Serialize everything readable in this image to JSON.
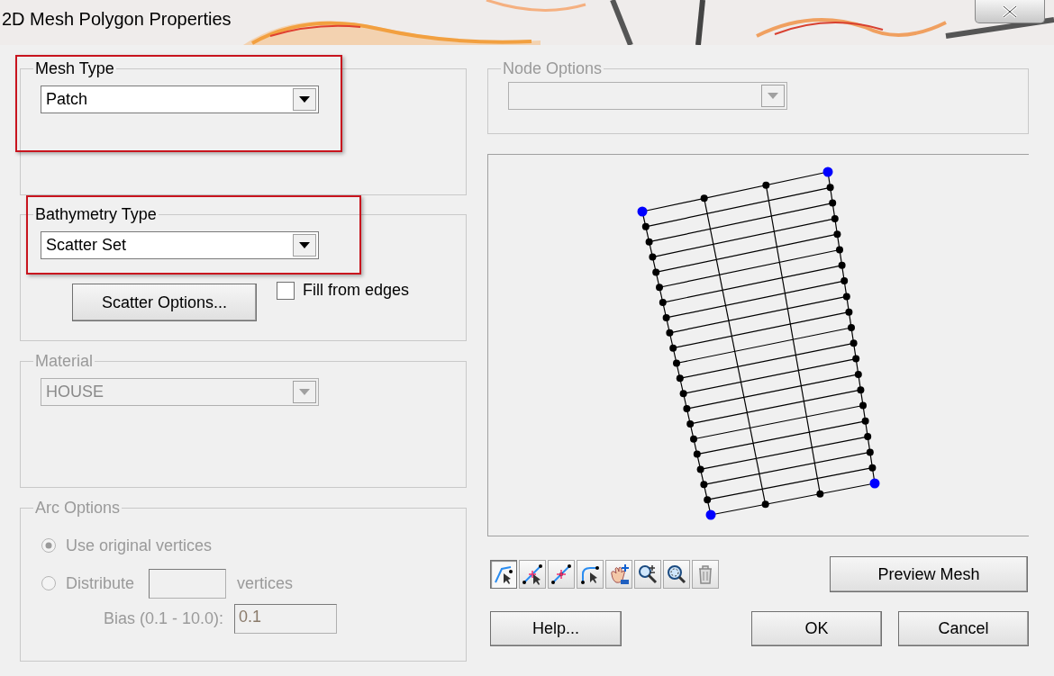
{
  "window": {
    "title": "2D Mesh Polygon Properties"
  },
  "mesh_type": {
    "legend": "Mesh Type",
    "value": "Patch",
    "highlighted": true
  },
  "bathymetry_type": {
    "legend": "Bathymetry Type",
    "value": "Scatter Set",
    "highlighted": true,
    "scatter_button": "Scatter Options...",
    "fill_from_edges": {
      "label": "Fill from edges",
      "checked": false
    }
  },
  "material": {
    "legend": "Material",
    "value": "HOUSE",
    "disabled": true
  },
  "arc_options": {
    "legend": "Arc Options",
    "disabled": true,
    "options": [
      {
        "label": "Use original vertices",
        "selected": true
      },
      {
        "label": "Distribute",
        "selected": false
      }
    ],
    "vertices_label": "vertices",
    "bias_label": "Bias (0.1 - 10.0):",
    "bias_value": "0.1"
  },
  "node_options": {
    "legend": "Node Options",
    "disabled": true
  },
  "tools": [
    {
      "kind": "select",
      "selected": true
    },
    {
      "kind": "add-node",
      "selected": false
    },
    {
      "kind": "split",
      "selected": false
    },
    {
      "kind": "edit-arc",
      "selected": false
    },
    {
      "kind": "pan",
      "selected": false
    },
    {
      "kind": "zoom",
      "selected": false
    },
    {
      "kind": "zoom-extents",
      "selected": false
    },
    {
      "kind": "delete",
      "selected": false
    }
  ],
  "buttons": {
    "preview": "Preview Mesh",
    "help": "Help...",
    "ok": "OK",
    "cancel": "Cancel"
  }
}
